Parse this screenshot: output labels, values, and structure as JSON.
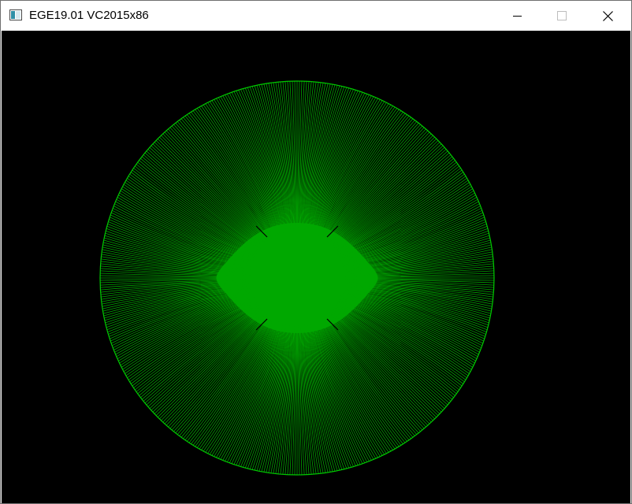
{
  "window": {
    "title": "EGE19.01 VC2015x86",
    "icon": "app-window-icon",
    "buttons": {
      "minimize_icon": "minimize-icon",
      "maximize_icon": "maximize-icon",
      "close_icon": "close-icon"
    }
  },
  "canvas": {
    "background_color": "#000000",
    "figure": {
      "shape": "circle",
      "line_color": "#00a800",
      "outline_color": "#00c800"
    }
  }
}
